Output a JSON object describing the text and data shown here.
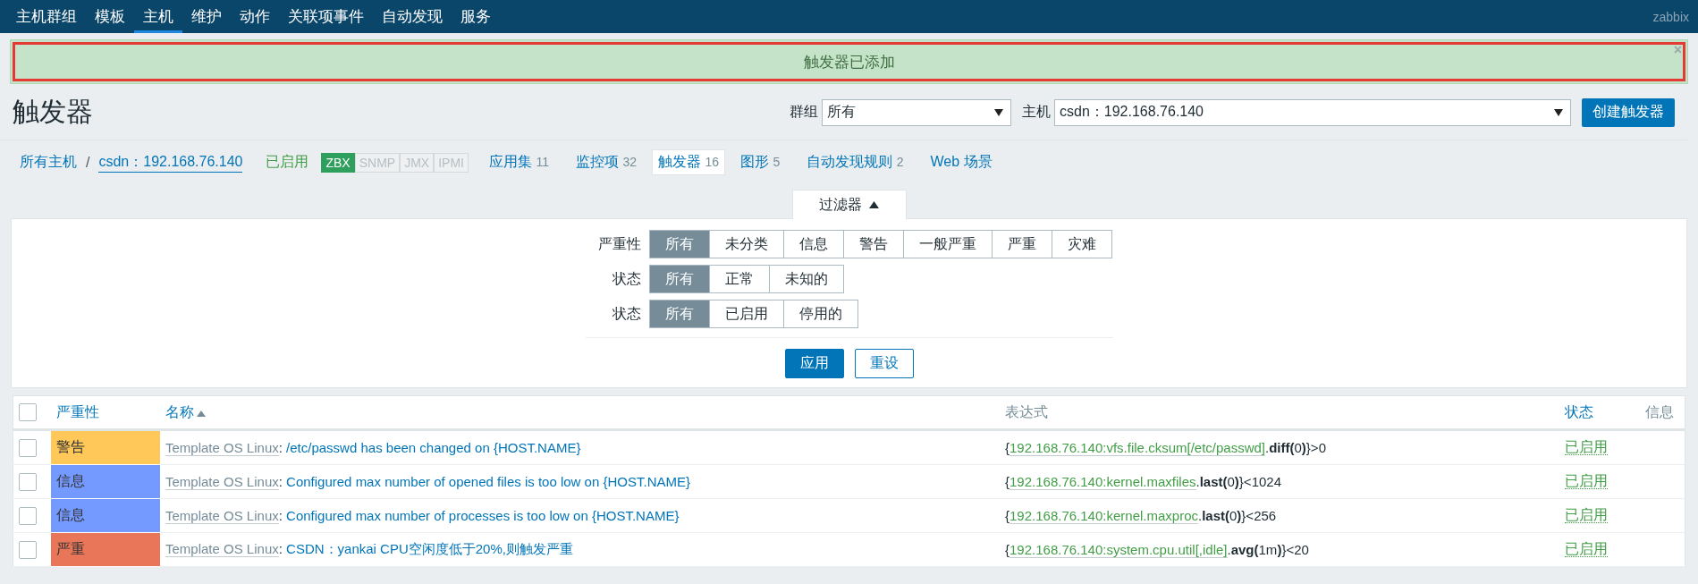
{
  "nav": {
    "items": [
      {
        "label": "主机群组",
        "selected": false
      },
      {
        "label": "模板",
        "selected": false
      },
      {
        "label": "主机",
        "selected": true
      },
      {
        "label": "维护",
        "selected": false
      },
      {
        "label": "动作",
        "selected": false
      },
      {
        "label": "关联项事件",
        "selected": false
      },
      {
        "label": "自动发现",
        "selected": false
      },
      {
        "label": "服务",
        "selected": false
      }
    ],
    "brand": "zabbix"
  },
  "message": {
    "text": "触发器已添加",
    "close": "×"
  },
  "header": {
    "title": "触发器",
    "group_label": "群组",
    "group_value": "所有",
    "host_label": "主机",
    "host_value": "csdn：192.168.76.140",
    "create_button": "创建触发器"
  },
  "breadcrumb": {
    "root": "所有主机",
    "separator": "/",
    "host": "csdn：192.168.76.140",
    "status": "已启用",
    "availability": [
      {
        "label": "ZBX",
        "on": true
      },
      {
        "label": "SNMP",
        "on": false
      },
      {
        "label": "JMX",
        "on": false
      },
      {
        "label": "IPMI",
        "on": false
      }
    ],
    "tabs": [
      {
        "label": "应用集",
        "count": "11",
        "selected": false
      },
      {
        "label": "监控项",
        "count": "32",
        "selected": false
      },
      {
        "label": "触发器",
        "count": "16",
        "selected": true
      },
      {
        "label": "图形",
        "count": "5",
        "selected": false
      },
      {
        "label": "自动发现规则",
        "count": "2",
        "selected": false
      },
      {
        "label": "Web 场景",
        "selected": false
      }
    ]
  },
  "filter": {
    "toggle": "过滤器",
    "expanded": true,
    "rows": [
      {
        "label": "严重性",
        "options": [
          {
            "label": "所有",
            "selected": true
          },
          {
            "label": "未分类",
            "selected": false
          },
          {
            "label": "信息",
            "selected": false
          },
          {
            "label": "警告",
            "selected": false
          },
          {
            "label": "一般严重",
            "selected": false
          },
          {
            "label": "严重",
            "selected": false
          },
          {
            "label": "灾难",
            "selected": false
          }
        ]
      },
      {
        "label": "状态",
        "options": [
          {
            "label": "所有",
            "selected": true
          },
          {
            "label": "正常",
            "selected": false
          },
          {
            "label": "未知的",
            "selected": false
          }
        ]
      },
      {
        "label": "状态",
        "options": [
          {
            "label": "所有",
            "selected": true
          },
          {
            "label": "已启用",
            "selected": false
          },
          {
            "label": "停用的",
            "selected": false
          }
        ]
      }
    ],
    "apply": "应用",
    "reset": "重设"
  },
  "table": {
    "select_all": false,
    "columns": [
      {
        "label": "严重性",
        "kind": "link"
      },
      {
        "label": "名称",
        "kind": "sorted"
      },
      {
        "label": "表达式",
        "kind": "plain"
      },
      {
        "label": "状态",
        "kind": "link"
      },
      {
        "label": "信息",
        "kind": "plain"
      }
    ],
    "rows": [
      {
        "checked": false,
        "severity": "警告",
        "color": "#ffc859",
        "template": "Template OS Linux",
        "separator": ":",
        "name": "/etc/passwd has been changed on {HOST.NAME}",
        "expr_open": "{",
        "expr_item": "192.168.76.140:vfs.file.cksum[/etc/passwd]",
        "expr_rest": ".**diff(**0**)**}>0",
        "status": "已启用"
      },
      {
        "checked": false,
        "severity": "信息",
        "color": "#7499ff",
        "template": "Template OS Linux",
        "separator": ":",
        "name": "Configured max number of opened files is too low on {HOST.NAME}",
        "expr_open": "{",
        "expr_item": "192.168.76.140:kernel.maxfiles",
        "expr_rest": ".**last(**0**)**}<1024",
        "status": "已启用"
      },
      {
        "checked": false,
        "severity": "信息",
        "color": "#7499ff",
        "template": "Template OS Linux",
        "separator": ":",
        "name": "Configured max number of processes is too low on {HOST.NAME}",
        "expr_open": "{",
        "expr_item": "192.168.76.140:kernel.maxproc",
        "expr_rest": ".**last(**0**)**}<256",
        "status": "已启用"
      },
      {
        "checked": false,
        "severity": "严重",
        "color": "#e97659",
        "template": "Template OS Linux",
        "separator": ":",
        "name": "CSDN：yankai CPU空闲度低于20%,则触发严重",
        "expr_open": "{",
        "expr_item": "192.168.76.140:system.cpu.util[,idle]",
        "expr_rest": ".**avg(**1m**)**}<20",
        "status": "已启用"
      }
    ]
  }
}
